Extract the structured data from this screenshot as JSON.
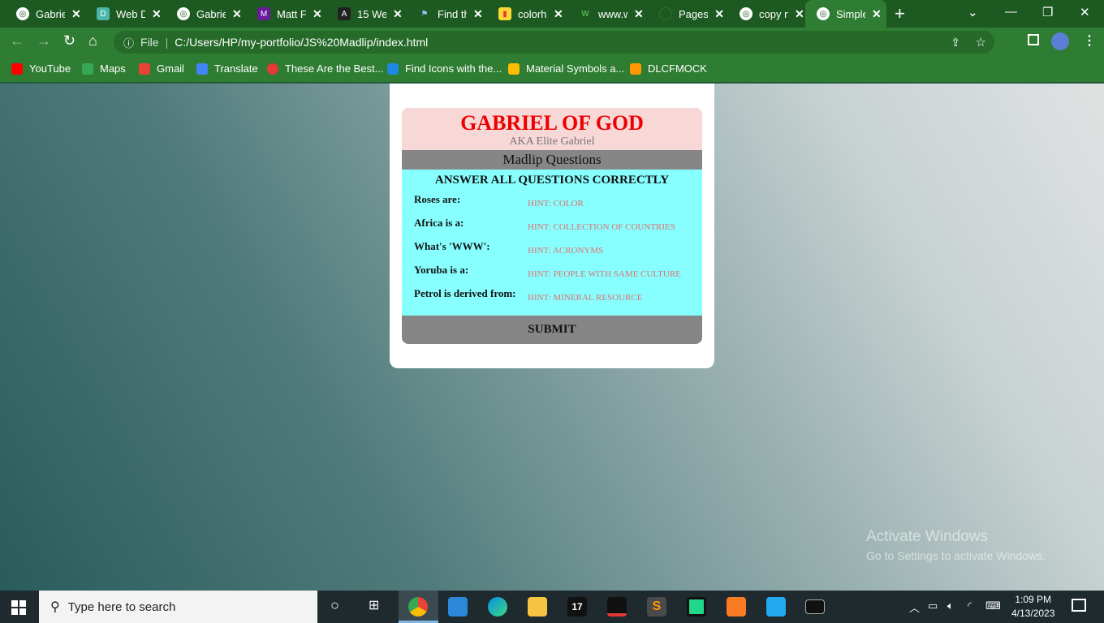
{
  "browser": {
    "tabs": [
      {
        "title": "Gabriel",
        "favicon": "globe-icon"
      },
      {
        "title": "Web D",
        "favicon": "web-d-icon"
      },
      {
        "title": "Gabriel",
        "favicon": "globe-icon"
      },
      {
        "title": "Matt F",
        "favicon": "purple-logo-icon"
      },
      {
        "title": "15 We",
        "favicon": "code-icon"
      },
      {
        "title": "Find th",
        "favicon": "flag-icon"
      },
      {
        "title": "colorh",
        "favicon": "colorhunt-icon"
      },
      {
        "title": "www.w",
        "favicon": "w3-icon"
      },
      {
        "title": "Pages",
        "favicon": "github-icon"
      },
      {
        "title": "copy n",
        "favicon": "globe-icon"
      },
      {
        "title": "Simple",
        "favicon": "globe-icon"
      }
    ],
    "address": {
      "scheme_label": "File",
      "url": "C:/Users/HP/my-portfolio/JS%20Madlip/index.html"
    },
    "bookmarks": [
      {
        "label": "YouTube",
        "color": "#ff0000"
      },
      {
        "label": "Maps",
        "color": "#34a853"
      },
      {
        "label": "Gmail",
        "color": "#ea4335"
      },
      {
        "label": "Translate",
        "color": "#4285f4"
      },
      {
        "label": "These Are the Best...",
        "color": "#e53935"
      },
      {
        "label": "Find Icons with the...",
        "color": "#1e88e5"
      },
      {
        "label": "Material Symbols a...",
        "color": "#fbbc05"
      },
      {
        "label": "DLCFMOCK",
        "color": "#ff9800"
      }
    ]
  },
  "page": {
    "title": "GABRIEL OF GOD",
    "subtitle": "AKA Elite Gabriel",
    "section": "Madlip Questions",
    "instruction": "ANSWER ALL QUESTIONS CORRECTLY",
    "questions": [
      {
        "label": "Roses are:",
        "placeholder": "HINT: COLOR"
      },
      {
        "label": "Africa is a:",
        "placeholder": "HINT: COLLECTION OF COUNTRIES"
      },
      {
        "label": "What's 'WWW':",
        "placeholder": "HINT: ACRONYMS"
      },
      {
        "label": "Yoruba is a:",
        "placeholder": "HINT: PEOPLE WITH SAME CULTURE"
      },
      {
        "label": "Petrol is derived from:",
        "placeholder": "HINT: MINERAL RESOURCE"
      }
    ],
    "submit_label": "SUBMIT"
  },
  "watermark": {
    "line1": "Activate Windows",
    "line2": "Go to Settings to activate Windows."
  },
  "taskbar": {
    "search_placeholder": "Type here to search",
    "time": "1:09 PM",
    "date": "4/13/2023"
  }
}
